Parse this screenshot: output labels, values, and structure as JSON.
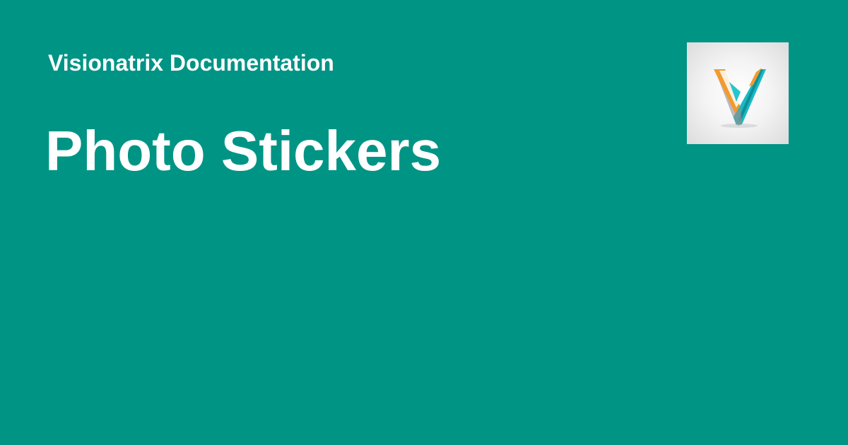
{
  "header": {
    "site_name": "Visionatrix Documentation",
    "page_title": "Photo Stickers"
  },
  "logo": {
    "icon": "visionatrix-v-logo-icon",
    "colors": {
      "teal": "#1bb9c2",
      "orange": "#f39a2d",
      "shadow": "#b9bcbf"
    }
  },
  "theme": {
    "background": "#009485",
    "text": "#ffffff"
  }
}
